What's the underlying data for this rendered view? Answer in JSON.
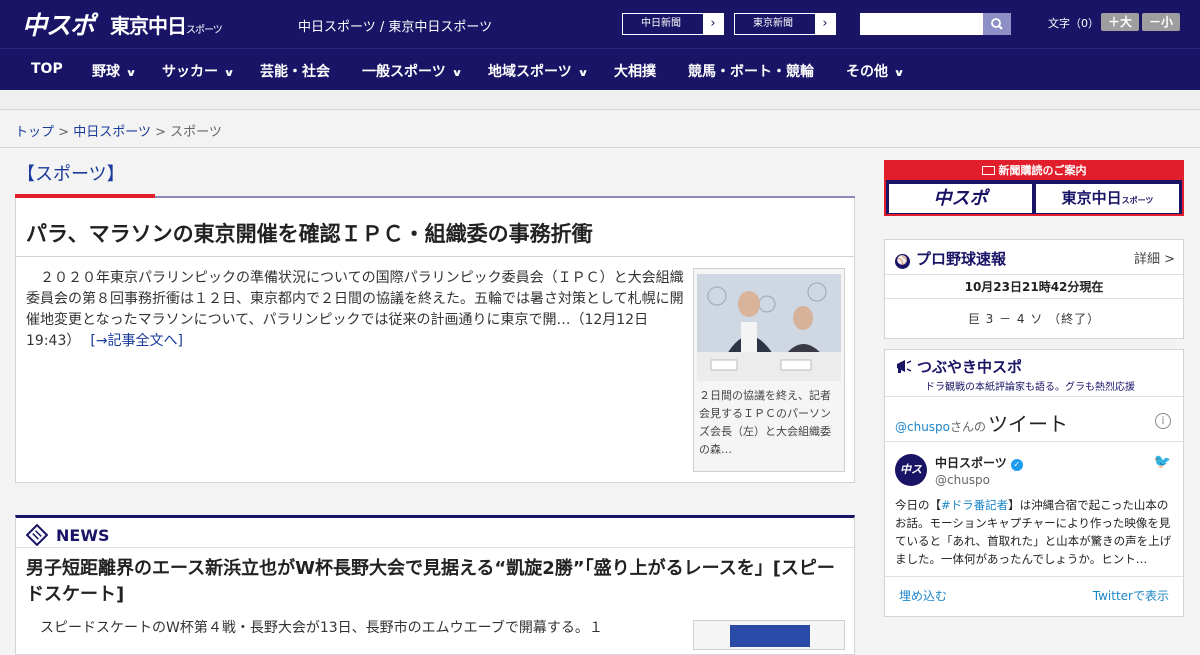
{
  "header": {
    "logo_chuspo": "中スポ",
    "logo_tokyo": "東京中日",
    "logo_tokyo_small": "スポーツ",
    "site_name": "中日スポーツ / 東京中日スポーツ",
    "paper_buttons": [
      {
        "label": "中日新聞",
        "arrow": "›"
      },
      {
        "label": "東京新聞",
        "arrow": "›"
      }
    ],
    "search_placeholder": "",
    "font_label": "文字（0）",
    "font_bigger": "＋大",
    "font_smaller": "－小"
  },
  "nav": {
    "items": [
      {
        "label": "TOP",
        "has_menu": false
      },
      {
        "label": "野球",
        "has_menu": true
      },
      {
        "label": "サッカー",
        "has_menu": true
      },
      {
        "label": "芸能・社会",
        "has_menu": false
      },
      {
        "label": "一般スポーツ",
        "has_menu": true
      },
      {
        "label": "地域スポーツ",
        "has_menu": true
      },
      {
        "label": "大相撲",
        "has_menu": false
      },
      {
        "label": "競馬・ボート・競輪",
        "has_menu": false
      },
      {
        "label": "その他",
        "has_menu": true
      }
    ],
    "chevron": "∨"
  },
  "breadcrumb": {
    "items": [
      "トップ",
      "中日スポーツ",
      "スポーツ"
    ],
    "separator": ">"
  },
  "main": {
    "section_title": "【スポーツ】",
    "article": {
      "title": "パラ、マラソンの東京開催を確認ＩＰＣ・組織委の事務折衝",
      "body": "２０２０年東京パラリンピックの準備状況についての国際パラリンピック委員会（ＩＰＣ）と大会組織委員会の第８回事務折衝は１２日、東京都内で２日間の協議を終えた。五輪では暑さ対策として札幌に開催地変更となったマラソンについて、パラリンピックでは従来の計画通りに東京で開…（12月12日 19:43）",
      "more_link": "[→記事全文へ]",
      "photo_caption": "２日間の協議を終え、記者会見するＩＰＣのパーソンズ会長（左）と大会組織委の森…"
    },
    "news": {
      "label": "NEWS",
      "title": "男子短距離界のエース新浜立也がW杯長野大会で見据える“凱旋2勝”「盛り上がるレースを」[スピードスケート]",
      "body": "スピードスケートのW杯第４戦・長野大会が13日、長野市のエムウエーブで開幕する。１"
    }
  },
  "sidebar": {
    "subscribe": {
      "title": "新聞購読のご案内",
      "btn_chuspo": "中スポ",
      "btn_tokyo": "東京中日"
    },
    "baseball": {
      "title": "プロ野球速報",
      "detail": "詳細 >",
      "updated": "10月23日21時42分現在",
      "score": "巨 3 － 4 ソ （終了）"
    },
    "tweets": {
      "title": "つぶやき中スポ",
      "subtitle": "ドラ観戦の本紙評論家も語る。グラも熱烈応援",
      "handle_line": "@chuspo",
      "handle_suffix": "さんの",
      "tweet_word": "ツイート",
      "account_name": "中日スポーツ",
      "account_handle": "@chuspo",
      "avatar_text": "中スポ",
      "text_prefix": "今日の【",
      "text_tag": "#ドラ番記者",
      "text_rest": "】は沖縄合宿で起こった山本のお話。モーションキャプチャーにより作った映像を見ていると「あれ、首取れた」と山本が驚きの声を上げました。一体何があったんでしょうか。ヒント…",
      "embed": "埋め込む",
      "view_on": "Twitterで表示"
    }
  },
  "colors": {
    "navy": "#1a1466",
    "red": "#e11f2c",
    "link": "#1a3b9b"
  }
}
